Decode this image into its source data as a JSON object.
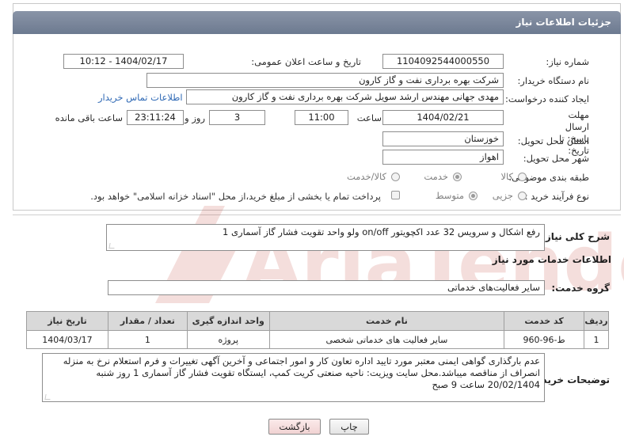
{
  "header": {
    "title": "جزئیات اطلاعات نیاز"
  },
  "form": {
    "need_number_label": "شماره نیاز:",
    "need_number": "1104092544000550",
    "announce_label": "تاریخ و ساعت اعلان عمومی:",
    "announce_value": "1404/02/17 - 10:12",
    "buyer_org_label": "نام دستگاه خریدار:",
    "buyer_org": "شرکت بهره برداری نفت و گاز کارون",
    "creator_label": "ایجاد کننده درخواست:",
    "creator": "مهدی جهانی مهندس ارشد سویل شرکت بهره برداری نفت و گاز کارون",
    "contact_link": "اطلاعات تماس خریدار",
    "deadline_label": "مهلت ارسال پاسخ: تا تاریخ:",
    "deadline_date": "1404/02/21",
    "time_label": "ساعت",
    "deadline_time": "11:00",
    "days_value": "3",
    "days_label": "روز و",
    "remaining_value": "23:11:24",
    "remaining_label": "ساعت باقی مانده",
    "province_label": "استان محل تحویل:",
    "province": "خوزستان",
    "city_label": "شهر محل تحویل:",
    "city": "اهواز",
    "category_label": "طبقه بندی موضوعی:",
    "category_options": [
      "کالا",
      "خدمت",
      "کالا/خدمت"
    ],
    "category_selected": "خدمت",
    "process_label": "نوع فرآیند خرید :",
    "process_options": [
      "جزیی",
      "متوسط"
    ],
    "process_selected": "جزیی",
    "payment_note": "پرداخت تمام یا بخشی از مبلغ خرید،از محل \"اسناد خزانه اسلامی\" خواهد بود."
  },
  "summary": {
    "label": "شرح کلی نیاز:",
    "text": "رفع اشکال و سرویس 32 عدد اکچویتور on/off ولو واحد تقویت فشار گاز آسماری 1"
  },
  "services": {
    "section_title": "اطلاعات خدمات مورد نیاز",
    "group_label": "گروه خدمت:",
    "group_value": "سایر فعالیت‌های خدماتی",
    "columns": [
      "ردیف",
      "کد خدمت",
      "نام خدمت",
      "واحد اندازه گیری",
      "تعداد / مقدار",
      "تاریخ نیاز"
    ],
    "rows": [
      [
        "1",
        "ط-96-960",
        "سایر فعالیت های خدماتی شخصی",
        "پروژه",
        "1",
        "1404/03/17"
      ]
    ]
  },
  "buyer_notes": {
    "label": "توضیحات خریدار:",
    "text": "عدم بارگذاری گواهی ایمنی معتبر مورد تایید اداره تعاون کار و امور اجتماعی و آخرین آگهی تغییرات و فرم استعلام نرخ به منزله انصراف از مناقصه میباشد.محل سایت ویزیت: ناحیه صنعتی کریت کمپ، ایستگاه تقویت فشار گاز آسماری 1 روز شنبه 20/02/1404 ساعت 9 صبح"
  },
  "buttons": {
    "print": "چاپ",
    "back": "بازگشت"
  },
  "watermark": {
    "text": "AriaTender.net"
  },
  "colors": {
    "header": "#7b879b",
    "link": "#2f69b5",
    "back_button": "#f6dede",
    "watermark": "#c0392b"
  }
}
